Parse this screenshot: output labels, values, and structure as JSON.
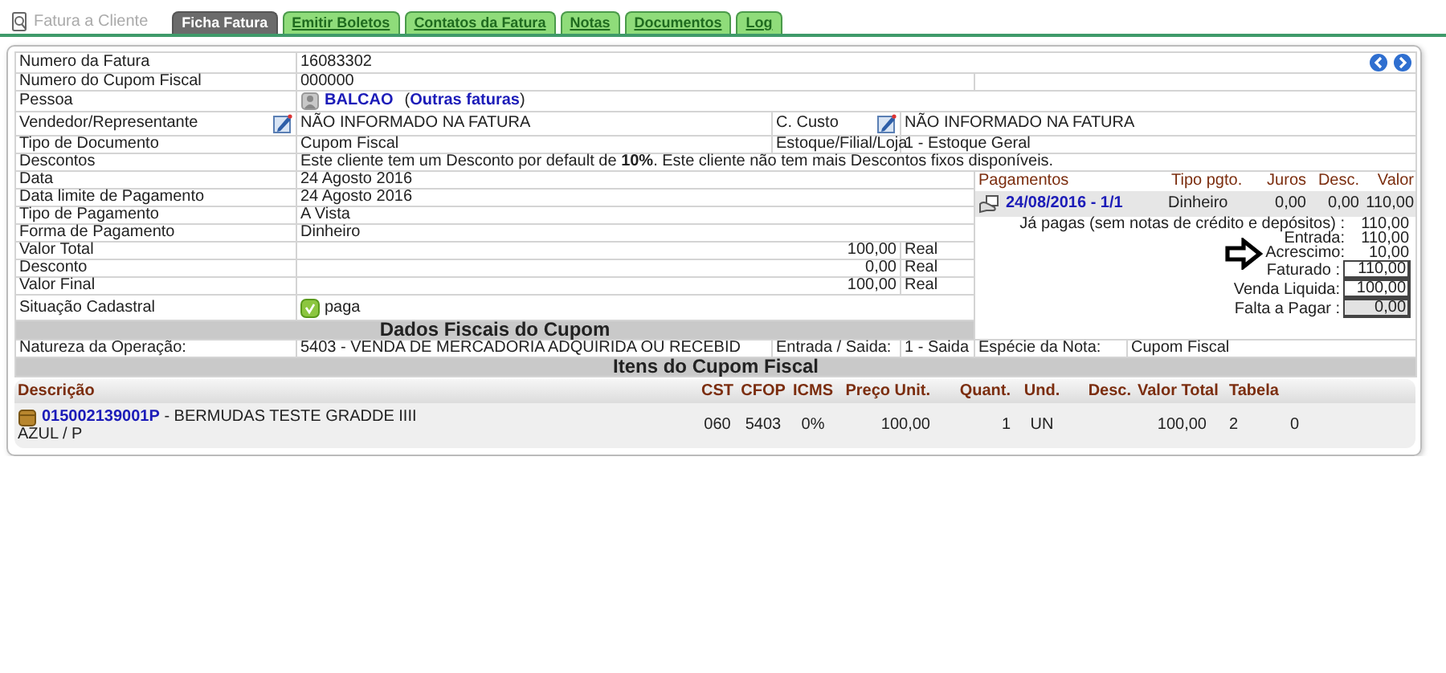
{
  "header": {
    "title": "Fatura a Cliente"
  },
  "tabs": [
    {
      "label": "Ficha Fatura",
      "selected": true
    },
    {
      "label": "Emitir Boletos",
      "selected": false
    },
    {
      "label": "Contatos da Fatura",
      "selected": false
    },
    {
      "label": "Notas",
      "selected": false
    },
    {
      "label": "Documentos",
      "selected": false
    },
    {
      "label": "Log",
      "selected": false
    }
  ],
  "invoice": {
    "number": {
      "label": "Numero da Fatura",
      "value": "16083302"
    },
    "coupon_number": {
      "label": "Numero do Cupom Fiscal",
      "value": "000000"
    },
    "person": {
      "label": "Pessoa",
      "value": "BALCAO",
      "link": "(**Outras faturas**)"
    },
    "seller": {
      "label": "Vendedor/Representante",
      "value": "NÃO INFORMADO NA FATURA"
    },
    "cost_center": {
      "label": "C. Custo",
      "value": "NÃO INFORMADO NA FATURA"
    },
    "doc_type": {
      "label": "Tipo de Documento",
      "value": "Cupom Fiscal"
    },
    "stock": {
      "label": "Estoque/Filial/Loja",
      "value": "1 - Estoque Geral"
    },
    "discounts": {
      "label": "Descontos",
      "value": "Este cliente tem um Desconto por default de **10%**. Este cliente não tem mais Descontos fixos disponíveis."
    },
    "details": [
      {
        "label": "Data",
        "value": "24 Agosto 2016"
      },
      {
        "label": "Data limite de Pagamento",
        "value": "24 Agosto 2016"
      },
      {
        "label": "Tipo de Pagamento",
        "value": "A Vista"
      },
      {
        "label": "Forma de Pagamento",
        "value": "Dinheiro"
      }
    ],
    "amounts": [
      {
        "label": "Valor Total",
        "value": "100,00",
        "unit": "Real"
      },
      {
        "label": "Desconto",
        "value": "0,00",
        "unit": "Real"
      },
      {
        "label": "Valor Final",
        "value": "100,00",
        "unit": "Real"
      }
    ],
    "status": {
      "label": "Situação Cadastral",
      "value": "paga"
    }
  },
  "payments": {
    "columns": [
      "Pagamentos",
      "Tipo pgto.",
      "Juros",
      "Desc.",
      "Valor"
    ],
    "rows": [
      {
        "date": "24/08/2016 - 1/1",
        "type": "Dinheiro",
        "interest": "0,00",
        "discount": "0,00",
        "value": "110,00"
      }
    ],
    "summary": [
      {
        "label": "Já pagas (sem notas de crédito e depósitos) :",
        "value": "110,00",
        "kind": "plain",
        "pointed": false
      },
      {
        "label": "Entrada:",
        "value": "110,00",
        "kind": "plain",
        "pointed": false
      },
      {
        "label": "Acrescimo:",
        "value": "10,00",
        "kind": "plain",
        "pointed": true
      },
      {
        "label": "Faturado :",
        "value": "110,00",
        "kind": "boxed",
        "pointed": false
      },
      {
        "label": "Venda Liquida:",
        "value": "100,00",
        "kind": "boxed",
        "pointed": false
      },
      {
        "label": "Falta a Pagar :",
        "value": "0,00",
        "kind": "total",
        "pointed": false
      }
    ]
  },
  "fiscal": {
    "title": "Dados Fiscais do Cupom",
    "operation": {
      "label": "Natureza da Operação:",
      "value": "5403 - VENDA DE MERCADORIA ADQUIRIDA OU RECEBID"
    },
    "direction": {
      "label": "Entrada / Saida:",
      "value": "1 - Saida"
    },
    "species": {
      "label": "Espécie da Nota:",
      "value": "Cupom Fiscal"
    }
  },
  "items": {
    "title": "Itens do Cupom Fiscal",
    "columns": [
      "Descrição",
      "CST",
      "CFOP",
      "ICMS",
      "Preço Unit.",
      "Quant.",
      "Und.",
      "Desc.",
      "Valor Total",
      "Tabela"
    ],
    "rows": [
      {
        "code": "015002139001P",
        "name": "- BERMUDAS TESTE GRADDE IIII",
        "variant": "AZUL / P",
        "cst": "060",
        "cfop": "5403",
        "icms": "0%",
        "price": "100,00",
        "quantity": "1",
        "unit": "UN",
        "total": "100,00",
        "table": "2",
        "column_11": "0"
      }
    ]
  }
}
